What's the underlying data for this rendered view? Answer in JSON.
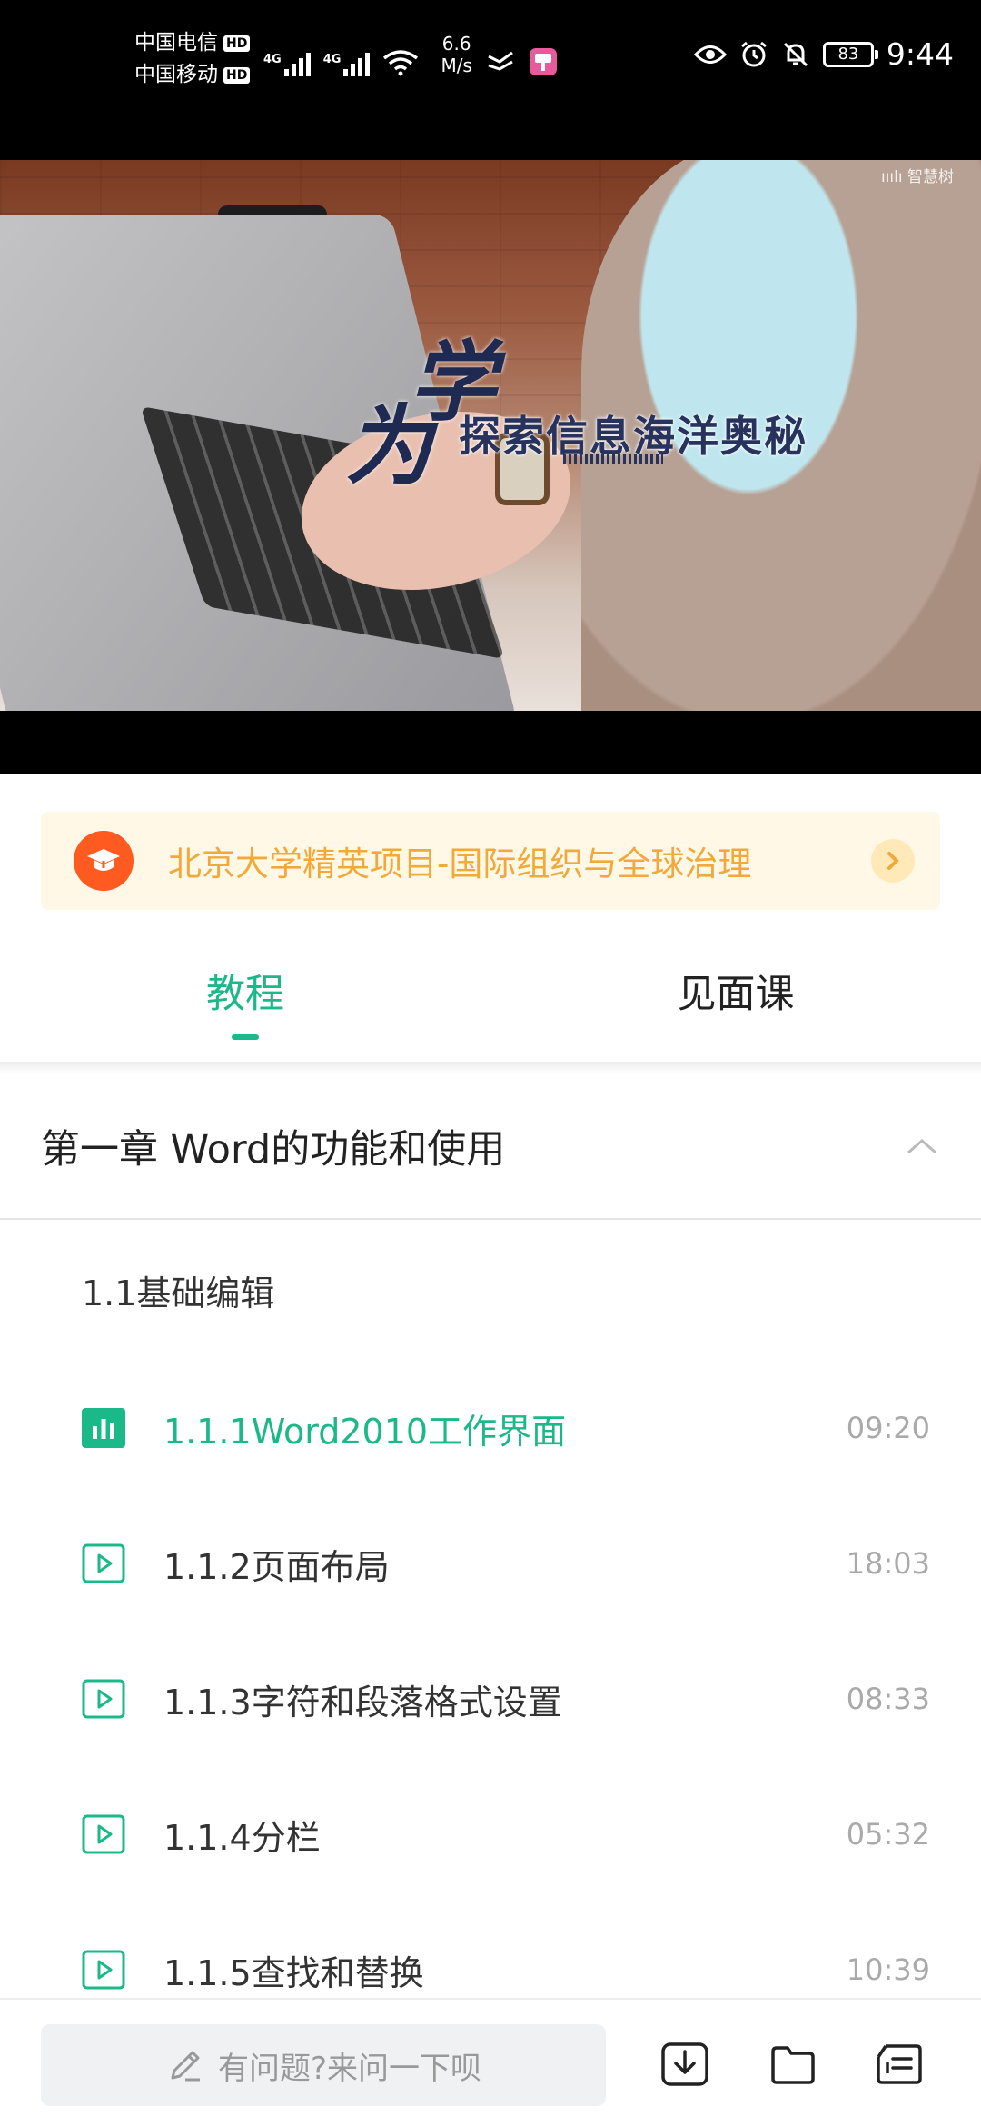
{
  "status_bar": {
    "carrier_1": "中国电信",
    "carrier_2": "中国移动",
    "hd_label": "HD",
    "network_1": "4G",
    "network_2": "4G",
    "speed_value": "6.6",
    "speed_unit": "M/s",
    "battery": "83",
    "time": "9:44"
  },
  "video": {
    "overlay_big": "学",
    "overlay_big_2": "为",
    "overlay_title": "探索信息海洋奥秘",
    "logo": "ııılı 智慧树"
  },
  "banner": {
    "text": "北京大学精英项目-国际组织与全球治理"
  },
  "tabs": [
    {
      "label": "教程",
      "active": true
    },
    {
      "label": "见面课",
      "active": false
    }
  ],
  "chapter": {
    "title": "第一章 Word的功能和使用"
  },
  "section": {
    "title": "1.1基础编辑"
  },
  "lessons": [
    {
      "title": "1.1.1Word2010工作界面",
      "duration": "09:20",
      "active": true
    },
    {
      "title": "1.1.2页面布局",
      "duration": "18:03",
      "active": false
    },
    {
      "title": "1.1.3字符和段落格式设置",
      "duration": "08:33",
      "active": false
    },
    {
      "title": "1.1.4分栏",
      "duration": "05:32",
      "active": false
    },
    {
      "title": "1.1.5查找和替换",
      "duration": "10:39",
      "active": false
    }
  ],
  "bottom_bar": {
    "ask_placeholder": "有问题?来问一下呗"
  },
  "colors": {
    "accent": "#1bb98a",
    "banner_text": "#f2a93b",
    "banner_bg": "#fff8e6"
  }
}
